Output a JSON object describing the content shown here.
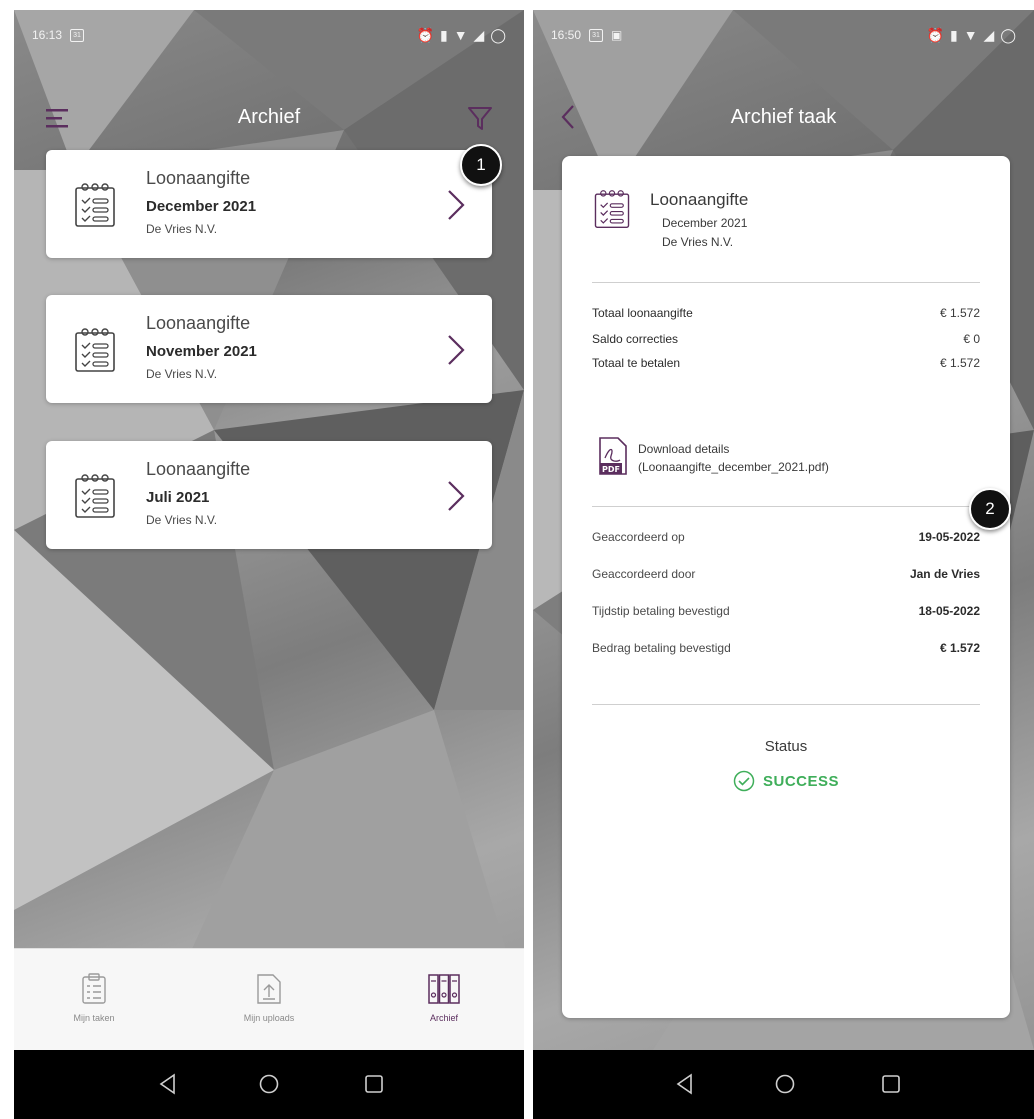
{
  "left": {
    "status_time": "16:13",
    "calendar_day": "31",
    "header_title": "Archief",
    "cards": [
      {
        "title": "Loonaangifte",
        "period": "December 2021",
        "company": "De Vries N.V."
      },
      {
        "title": "Loonaangifte",
        "period": "November 2021",
        "company": "De Vries N.V."
      },
      {
        "title": "Loonaangifte",
        "period": "Juli 2021",
        "company": "De Vries N.V."
      }
    ],
    "badge": "1",
    "tabs": [
      {
        "label": "Mijn taken",
        "icon": "clipboard-icon"
      },
      {
        "label": "Mijn uploads",
        "icon": "upload-icon"
      },
      {
        "label": "Archief",
        "icon": "archive-binders-icon"
      }
    ]
  },
  "right": {
    "status_time": "16:50",
    "calendar_day": "31",
    "header_title": "Archief taak",
    "task": {
      "title": "Loonaangifte",
      "period": "December 2021",
      "company": "De Vries N.V."
    },
    "totals": [
      {
        "label": "Totaal loonaangifte",
        "value": "€ 1.572"
      },
      {
        "label": "Saldo correcties",
        "value": "€ 0"
      },
      {
        "label": "Totaal te betalen",
        "value": "€ 1.572"
      }
    ],
    "download": {
      "line1": "Download details",
      "line2": "(Loonaangifte_december_2021.pdf)"
    },
    "badge": "2",
    "details": [
      {
        "label": "Geaccordeerd op",
        "value": "19-05-2022"
      },
      {
        "label": "Geaccordeerd door",
        "value": "Jan de Vries"
      },
      {
        "label": "Tijdstip betaling bevestigd",
        "value": "18-05-2022"
      },
      {
        "label": "Bedrag betaling bevestigd",
        "value": "€ 1.572"
      }
    ],
    "status_label": "Status",
    "status_value": "SUCCESS"
  },
  "colors": {
    "accent": "#5b2e5e",
    "success": "#3fae5a"
  }
}
